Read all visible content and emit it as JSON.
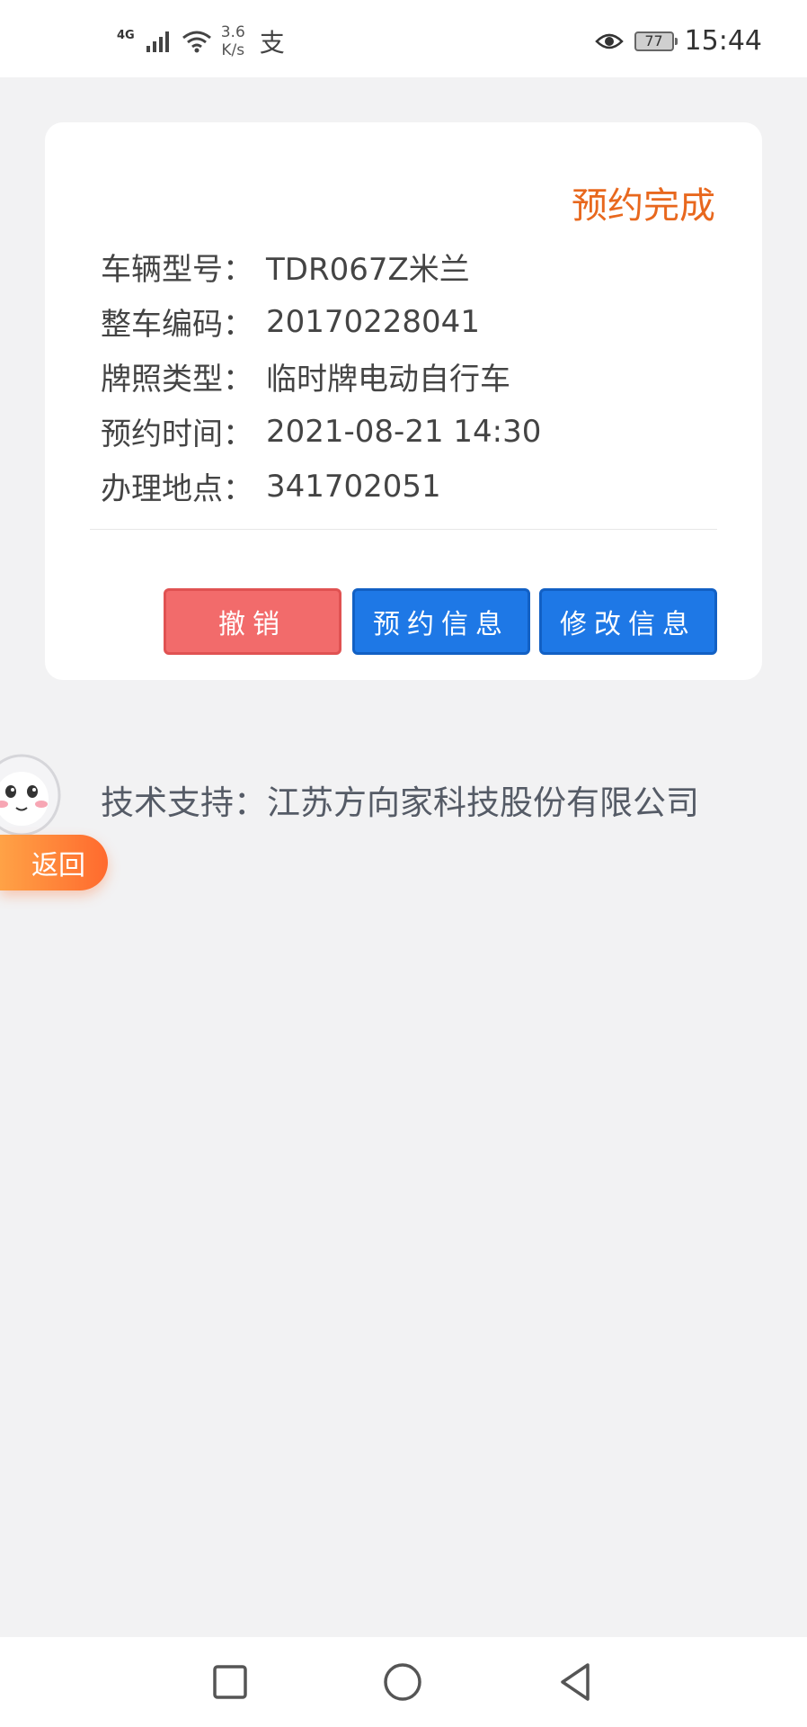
{
  "status_bar": {
    "network": "4G",
    "speed_value": "3.6",
    "speed_unit": "K/s",
    "battery": "77",
    "time": "15:44",
    "icons": [
      "signal-icon",
      "wifi-icon",
      "alipay-icon",
      "eye-icon",
      "battery-icon"
    ]
  },
  "card": {
    "status": "预约完成",
    "fields": [
      {
        "label": "车辆型号：",
        "value": "TDR067Z米兰"
      },
      {
        "label": "整车编码：",
        "value": "20170228041"
      },
      {
        "label": "牌照类型：",
        "value": "临时牌电动自行车"
      },
      {
        "label": "预约时间：",
        "value": "2021-08-21 14:30"
      },
      {
        "label": "办理地点：",
        "value": "341702051"
      }
    ],
    "buttons": {
      "cancel": "撤销",
      "appointment_info": "预约信息",
      "edit_info": "修改信息"
    }
  },
  "support_text": "技术支持：江苏方向家科技股份有限公司",
  "back_button": "返回",
  "nav": [
    "recent-apps-icon",
    "home-icon",
    "back-icon"
  ],
  "colors": {
    "status_orange": "#e8681e",
    "cancel_red": "#f26b6b",
    "primary_blue": "#1e78e6",
    "page_bg": "#f2f2f3",
    "back_gradient": "#ff8a3a"
  }
}
